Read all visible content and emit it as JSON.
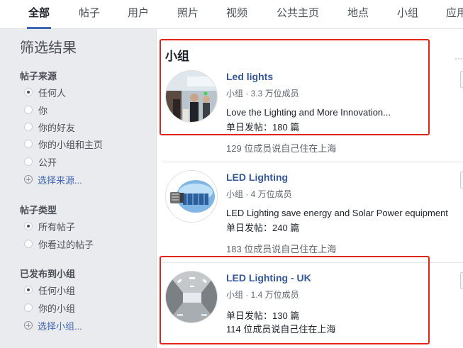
{
  "tabs": [
    {
      "label": "全部",
      "active": true
    },
    {
      "label": "帖子"
    },
    {
      "label": "用户"
    },
    {
      "label": "照片"
    },
    {
      "label": "视频"
    },
    {
      "label": "公共主页"
    },
    {
      "label": "地点"
    },
    {
      "label": "小组"
    },
    {
      "label": "应用"
    }
  ],
  "sidebar": {
    "title": "筛选结果",
    "post_source": {
      "title": "帖子来源",
      "options": [
        "任何人",
        "你",
        "你的好友",
        "你的小组和主页",
        "公开"
      ],
      "selected": "任何人",
      "more_link": "选择来源..."
    },
    "post_type": {
      "title": "帖子类型",
      "options": [
        "所有帖子",
        "你看过的帖子"
      ],
      "selected": "所有帖子"
    },
    "posted_in_group": {
      "title": "已发布到小组",
      "options": [
        "任何小组",
        "你的小组"
      ],
      "selected": "任何小组",
      "more_link": "选择小组..."
    }
  },
  "results": {
    "section_title": "小组",
    "groups": [
      {
        "name": "Led lights",
        "meta": "小组 · 3.3 万位成员",
        "description": "Love the Lighting and More Innovation...",
        "daily_posts": "单日发帖：180 篇",
        "local_members": "129 位成员说自己住在上海"
      },
      {
        "name": "LED Lighting",
        "meta": "小组 · 4 万位成员",
        "description": "LED Lighting save energy and Solar Power equipment",
        "daily_posts": "单日发帖：240 篇",
        "local_members": "183 位成员说自己住在上海"
      },
      {
        "name": "LED Lighting - UK",
        "meta": "小组 · 1.4 万位成员",
        "description": "",
        "daily_posts": "单日发帖：130 篇",
        "local_members": "114 位成员说自己住在上海"
      }
    ]
  },
  "colors": {
    "accent": "#4267b2",
    "link": "#365899",
    "highlight": "#e0261b",
    "background": "#e9ebee"
  }
}
